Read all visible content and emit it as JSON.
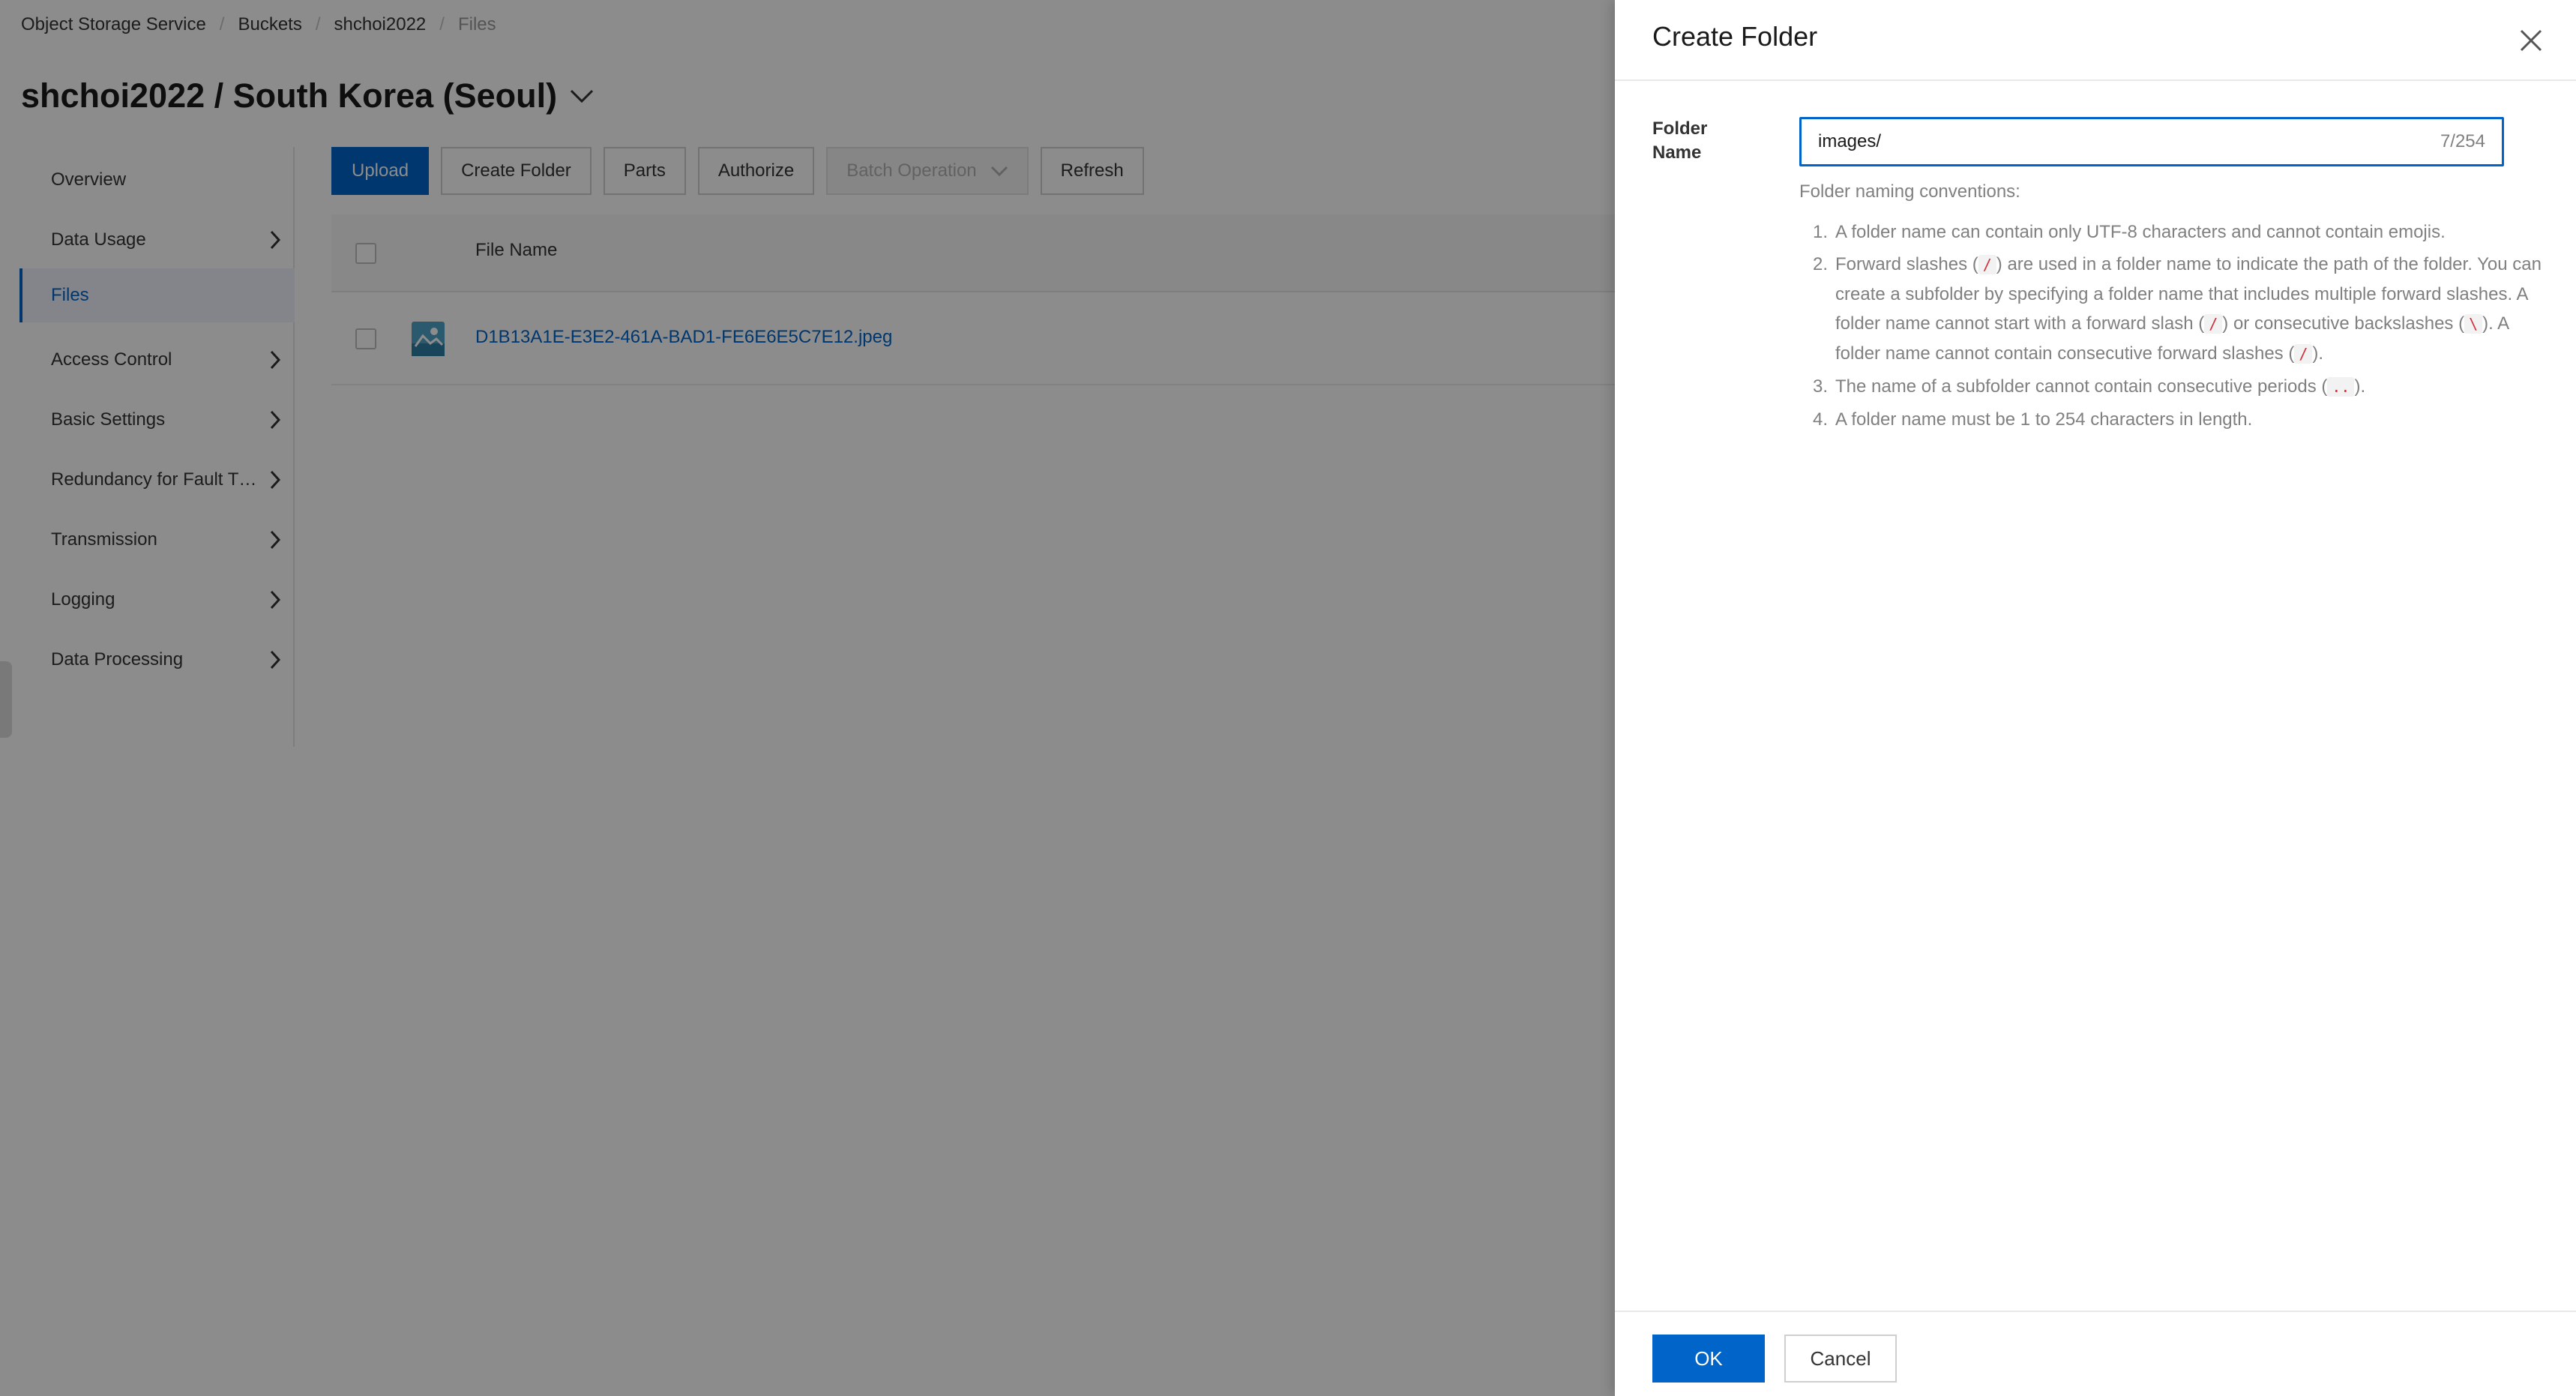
{
  "breadcrumb": [
    "Object Storage Service",
    "Buckets",
    "shchoi2022",
    "Files"
  ],
  "bucket_title": "shchoi2022 / South Korea (Seoul)",
  "sidebar": {
    "items": [
      {
        "label": "Overview",
        "has_arrow": false
      },
      {
        "label": "Data Usage",
        "has_arrow": true
      },
      {
        "label": "Files",
        "has_arrow": false,
        "active": true
      },
      {
        "label": "Access Control",
        "has_arrow": true
      },
      {
        "label": "Basic Settings",
        "has_arrow": true
      },
      {
        "label": "Redundancy for Fault T…",
        "has_arrow": true
      },
      {
        "label": "Transmission",
        "has_arrow": true
      },
      {
        "label": "Logging",
        "has_arrow": true
      },
      {
        "label": "Data Processing",
        "has_arrow": true
      }
    ]
  },
  "toolbar": {
    "upload": "Upload",
    "create_folder": "Create Folder",
    "parts": "Parts",
    "authorize": "Authorize",
    "batch_operation": "Batch Operation",
    "refresh": "Refresh"
  },
  "table": {
    "header_file_name": "File Name",
    "rows": [
      {
        "file_name": "D1B13A1E-E3E2-461A-BAD1-FE6E6E5C7E12.jpeg"
      }
    ]
  },
  "drawer": {
    "title": "Create Folder",
    "folder_name_label": "Folder Name",
    "folder_name_value": "images/",
    "char_count": "7/254",
    "conventions_title": "Folder naming conventions:",
    "rules": {
      "r1": "A folder name can contain only UTF-8 characters and cannot contain emojis.",
      "r2_a": "Forward slashes (",
      "r2_b": ") are used in a folder name to indicate the path of the folder. You can create a subfolder by specifying a folder name that includes multiple forward slashes. A folder name cannot start with a forward slash (",
      "r2_c": ") or consecutive backslashes (",
      "r2_d": "). A folder name cannot contain consecutive forward slashes (",
      "r2_e": ").",
      "r3_a": "The name of a subfolder cannot contain consecutive periods (",
      "r3_b": ").",
      "r4": "A folder name must be 1 to 254 characters in length."
    },
    "codes": {
      "slash": "/",
      "backslash": "\\",
      "periods": ".."
    },
    "ok": "OK",
    "cancel": "Cancel"
  },
  "colors": {
    "primary": "#0064c8",
    "code_red": "#d0323c"
  }
}
